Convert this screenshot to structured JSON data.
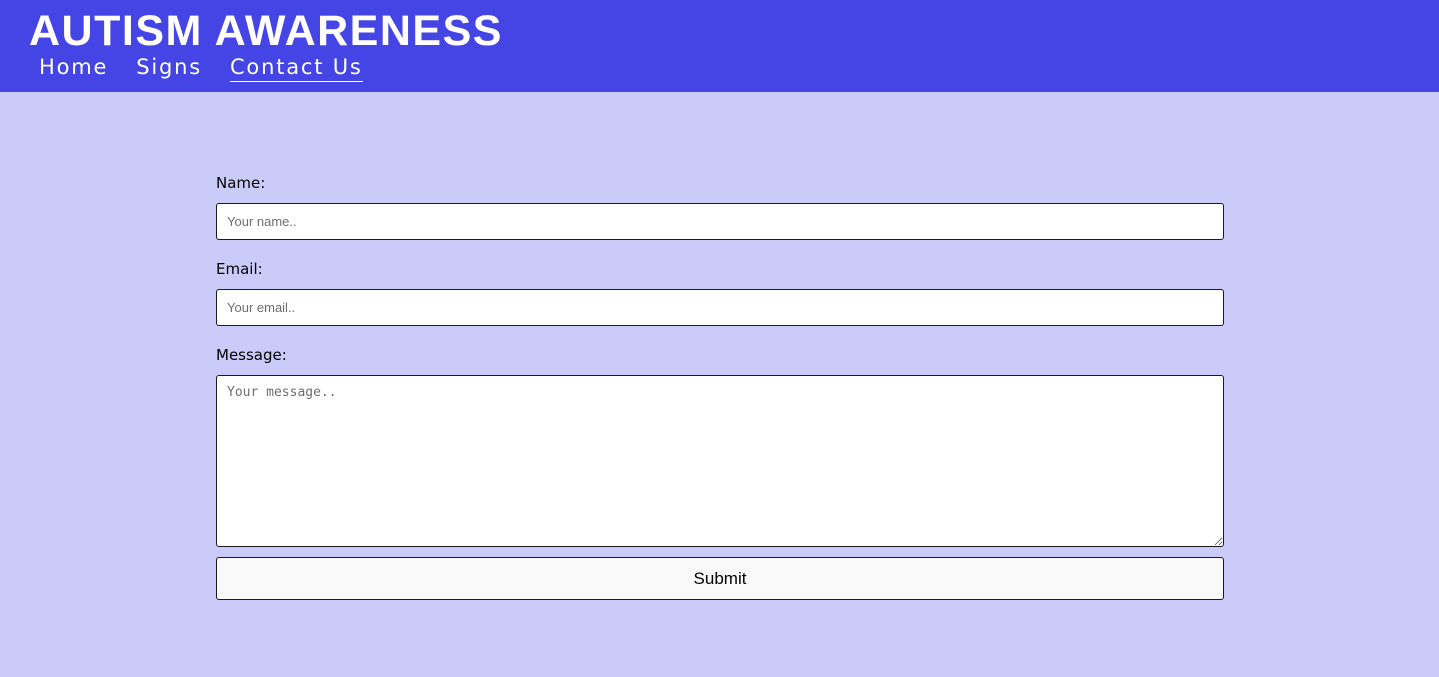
{
  "header": {
    "title": "AUTISM AWARENESS",
    "nav": [
      {
        "label": "Home"
      },
      {
        "label": "Signs"
      },
      {
        "label": "Contact Us",
        "active": true
      }
    ],
    "background_color": "#4545e6"
  },
  "page": {
    "background_color": "#cbcbf9"
  },
  "contact_form": {
    "name": {
      "label": "Name:",
      "value": "",
      "placeholder": "Your name.."
    },
    "email": {
      "label": "Email:",
      "value": "",
      "placeholder": "Your email.."
    },
    "message": {
      "label": "Message:",
      "value": "",
      "placeholder": "Your message.."
    },
    "submit_label": "Submit"
  }
}
